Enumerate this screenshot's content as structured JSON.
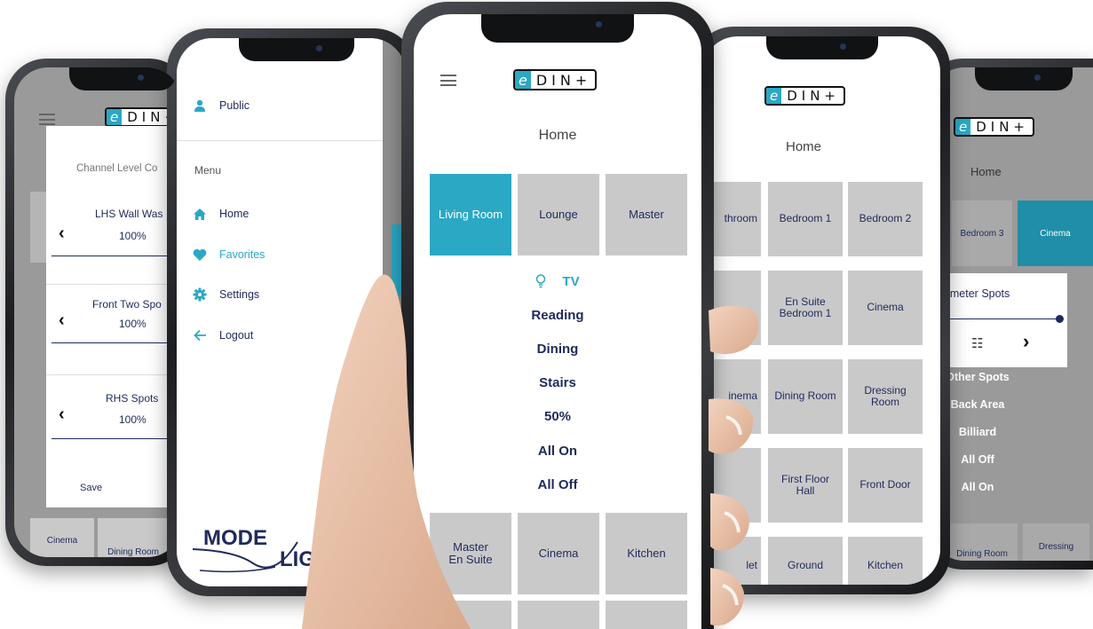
{
  "phone1": {
    "logo_e": "e",
    "logo_rest": "DIN+",
    "dialog_title": "Channel Level Co",
    "channels": [
      {
        "name": "LHS Wall Was",
        "level": "100%"
      },
      {
        "name": "Front Two Spo",
        "level": "100%"
      },
      {
        "name": "RHS Spots",
        "level": "100%"
      }
    ],
    "save_label": "Save",
    "bottom_tiles": [
      "Cinema",
      "Dining Room"
    ]
  },
  "phone2": {
    "user": "Public",
    "menu_heading": "Menu",
    "items": [
      {
        "label": "Home",
        "icon": "home-icon"
      },
      {
        "label": "Favorites",
        "icon": "heart-icon"
      },
      {
        "label": "Settings",
        "icon": "gear-icon"
      },
      {
        "label": "Logout",
        "icon": "arrow-left-icon"
      }
    ],
    "brand_line1": "MODE",
    "brand_line2": "LIG"
  },
  "phone3": {
    "logo_e": "e",
    "logo_rest": "DIN+",
    "title": "Home",
    "tiles_top": [
      "Living Room",
      "Lounge",
      "Master"
    ],
    "tv_label": "TV",
    "scenes": [
      "Reading",
      "Dining",
      "Stairs",
      "50%",
      "All On",
      "All Off"
    ],
    "tiles_bottom": [
      [
        "Master",
        "En Suite"
      ],
      [
        "Cinema"
      ],
      [
        "Kitchen"
      ]
    ]
  },
  "phone4": {
    "logo_e": "e",
    "logo_rest": "DIN+",
    "title": "Home",
    "tiles": [
      "throom",
      "Bedroom 1",
      "Bedroom 2",
      "",
      "En Suite\nBedroom 1",
      "Cinema",
      "inema",
      "Dining Room",
      "Dressing\nRoom",
      "",
      "First Floor\nHall",
      "Front Door",
      "let",
      "Ground",
      "Kitchen"
    ]
  },
  "phone5": {
    "logo_e": "e",
    "logo_rest": "DIN+",
    "title": "Home",
    "tiles_top": [
      "Bedroom 3",
      "Cinema"
    ],
    "popup_title": "erimeter Spots",
    "scenes": [
      "Other Spots",
      "Back Area",
      "Billiard",
      "All Off",
      "All On"
    ],
    "bottom_tiles": [
      "Dining Room",
      "Dressing"
    ]
  },
  "colors": {
    "accent": "#2aa8c4",
    "text": "#1f2a5c",
    "tile": "#c9c9c9"
  }
}
